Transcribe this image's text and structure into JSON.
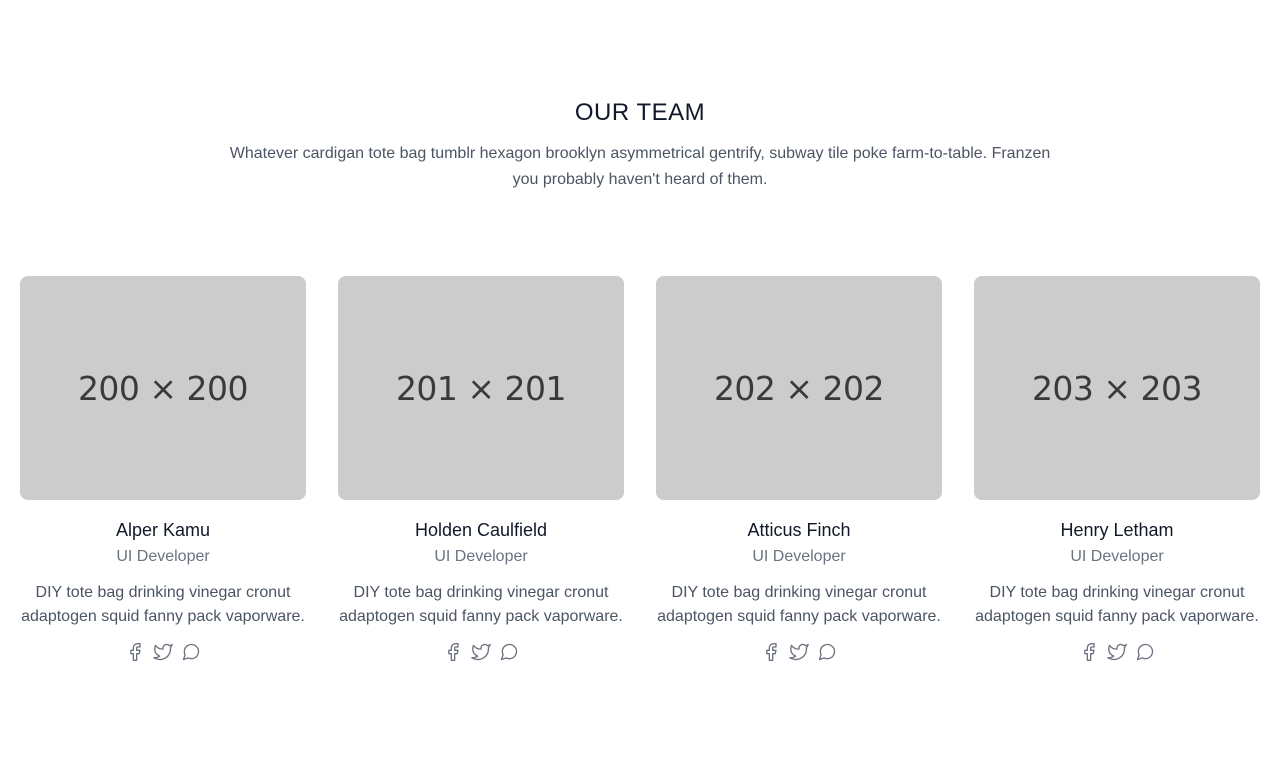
{
  "section": {
    "title": "OUR TEAM",
    "subtitle": "Whatever cardigan tote bag tumblr hexagon brooklyn asymmetrical gentrify, subway tile poke farm-to-table. Franzen you probably haven't heard of them."
  },
  "team": [
    {
      "photo_label": "200 × 200",
      "name": "Alper Kamu",
      "role": "UI Developer",
      "bio": "DIY tote bag drinking vinegar cronut adaptogen squid fanny pack vaporware.",
      "socials": [
        "facebook-icon",
        "twitter-icon",
        "message-icon"
      ]
    },
    {
      "photo_label": "201 × 201",
      "name": "Holden Caulfield",
      "role": "UI Developer",
      "bio": "DIY tote bag drinking vinegar cronut adaptogen squid fanny pack vaporware.",
      "socials": [
        "facebook-icon",
        "twitter-icon",
        "message-icon"
      ]
    },
    {
      "photo_label": "202 × 202",
      "name": "Atticus Finch",
      "role": "UI Developer",
      "bio": "DIY tote bag drinking vinegar cronut adaptogen squid fanny pack vaporware.",
      "socials": [
        "facebook-icon",
        "twitter-icon",
        "message-icon"
      ]
    },
    {
      "photo_label": "203 × 203",
      "name": "Henry Letham",
      "role": "UI Developer",
      "bio": "DIY tote bag drinking vinegar cronut adaptogen squid fanny pack vaporware.",
      "socials": [
        "facebook-icon",
        "twitter-icon",
        "message-icon"
      ]
    }
  ],
  "colors": {
    "photo_background": "#cccccc",
    "heading": "#111827",
    "body_text": "#4b5563",
    "muted_text": "#6b7280"
  }
}
